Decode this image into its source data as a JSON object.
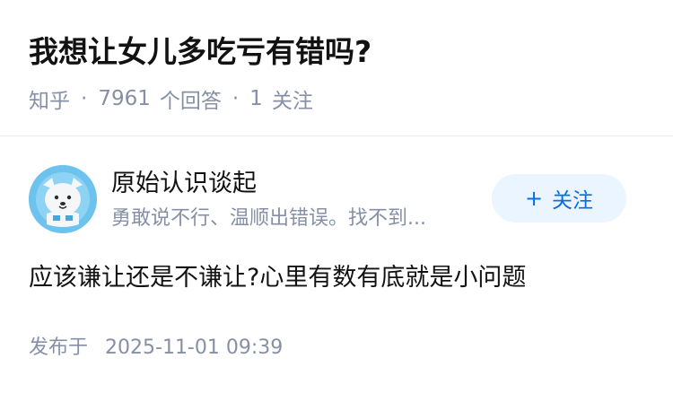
{
  "question": {
    "title": "我想让女儿多吃亏有错吗?"
  },
  "meta": {
    "source": "知乎",
    "separator": "·",
    "answer_count": "7961",
    "answer_label": "个回答",
    "follow_count": "1",
    "follow_label": "关注"
  },
  "author": {
    "name": "原始认识谈起",
    "bio": "勇敢说不行、温顺出错误。找不到...",
    "avatar_icon": "dog-avatar-icon",
    "follow_button": {
      "plus": "+",
      "label": "关注"
    }
  },
  "answer": {
    "content": "应该谦让还是不谦让?心里有数有底就是小问题"
  },
  "publish": {
    "label": "发布于",
    "datetime": "2025-11-01 09:39"
  },
  "colors": {
    "title": "#121212",
    "meta": "#8590a6",
    "follow_bg": "#ebf5ff",
    "follow_text": "#056de8",
    "avatar_bg": "#6ec3ee",
    "divider": "#ebebeb"
  }
}
